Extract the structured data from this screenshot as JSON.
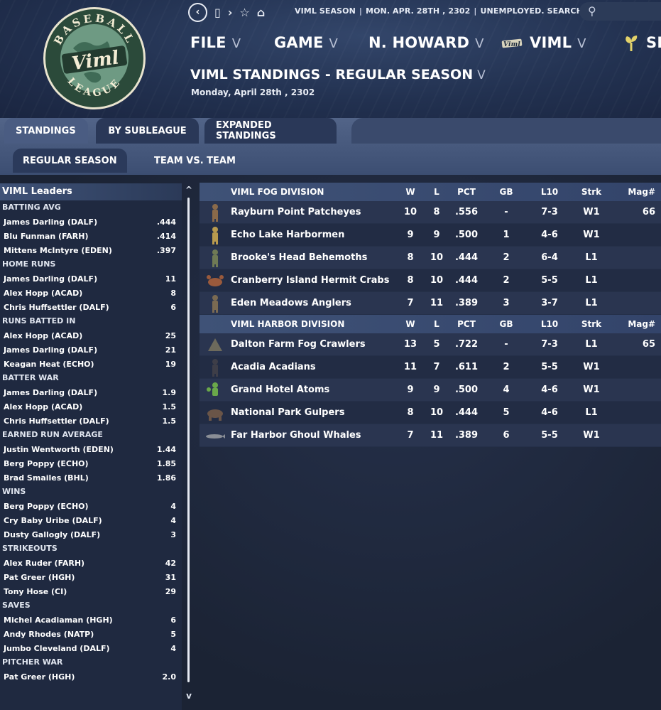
{
  "window": {
    "info": [
      "VIML SEASON",
      "MON. APR. 28TH , 2302",
      "UNEMPLOYED. SEARCH JOBS..."
    ],
    "nav_glyphs": [
      "‹",
      "▯",
      "›",
      "☆",
      "⌂"
    ]
  },
  "logo": {
    "text_top": "BASEBALL",
    "text_mid": "Viml",
    "text_bottom": "LEAGUE",
    "colors": {
      "ring": "#1d3a2a",
      "globe": "#5d8a72",
      "text": "#f3ecd4"
    }
  },
  "menu": [
    {
      "label": "FILE",
      "chev": "V"
    },
    {
      "label": "GAME",
      "chev": "V"
    },
    {
      "label": "N. HOWARD",
      "chev": "V"
    },
    {
      "label": "VIML",
      "chev": "V",
      "icon": "viml-logo-icon"
    },
    {
      "label": "SI",
      "icon": "sprout-icon"
    }
  ],
  "page": {
    "title": "VIML STANDINGS - REGULAR SEASON",
    "title_chev": "V",
    "date": "Monday, April 28th , 2302"
  },
  "tabs": [
    "STANDINGS",
    "BY SUBLEAGUE",
    "EXPANDED STANDINGS"
  ],
  "subtabs": [
    "REGULAR SEASON",
    "TEAM VS. TEAM"
  ],
  "leaders": {
    "title": "VIML Leaders",
    "categories": [
      {
        "name": "BATTING AVG",
        "rows": [
          [
            "James Darling (DALF)",
            ".444"
          ],
          [
            "Blu Funman (FARH)",
            ".414"
          ],
          [
            "Mittens McIntyre (EDEN)",
            ".397"
          ]
        ]
      },
      {
        "name": "HOME RUNS",
        "rows": [
          [
            "James Darling (DALF)",
            "11"
          ],
          [
            "Alex Hopp (ACAD)",
            "8"
          ],
          [
            "Chris Huffsettler (DALF)",
            "6"
          ]
        ]
      },
      {
        "name": "RUNS BATTED IN",
        "rows": [
          [
            "Alex Hopp (ACAD)",
            "25"
          ],
          [
            "James Darling (DALF)",
            "21"
          ],
          [
            "Keagan Heat (ECHO)",
            "19"
          ]
        ]
      },
      {
        "name": "BATTER WAR",
        "rows": [
          [
            "James Darling (DALF)",
            "1.9"
          ],
          [
            "Alex Hopp (ACAD)",
            "1.5"
          ],
          [
            "Chris Huffsettler (DALF)",
            "1.5"
          ]
        ]
      },
      {
        "name": "EARNED RUN AVERAGE",
        "rows": [
          [
            "Justin Wentworth (EDEN)",
            "1.44"
          ],
          [
            "Berg Poppy (ECHO)",
            "1.85"
          ],
          [
            "Brad Smailes (BHL)",
            "1.86"
          ]
        ]
      },
      {
        "name": "WINS",
        "rows": [
          [
            "Berg Poppy (ECHO)",
            "4"
          ],
          [
            "Cry Baby Uribe (DALF)",
            "4"
          ],
          [
            "Dusty Gallogly (DALF)",
            "3"
          ]
        ]
      },
      {
        "name": "STRIKEOUTS",
        "rows": [
          [
            "Alex Ruder (FARH)",
            "42"
          ],
          [
            "Pat Greer (HGH)",
            "31"
          ],
          [
            "Tony Hose (CI)",
            "29"
          ]
        ]
      },
      {
        "name": "SAVES",
        "rows": [
          [
            "Michel Acadiaman (HGH)",
            "6"
          ],
          [
            "Andy Rhodes (NATP)",
            "5"
          ],
          [
            "Jumbo Cleveland (DALF)",
            "4"
          ]
        ]
      },
      {
        "name": "PITCHER WAR",
        "rows": [
          [
            "Pat Greer (HGH)",
            "2.0"
          ]
        ]
      }
    ],
    "scroll_up": "^",
    "scroll_down": "v"
  },
  "columns": [
    "W",
    "L",
    "PCT",
    "GB",
    "L10",
    "Strk",
    "Mag#"
  ],
  "divisions": [
    {
      "name": "VIML FOG DIVISION",
      "teams": [
        {
          "icon": "pirate-icon",
          "color": "#8a6a4a",
          "name": "Rayburn Point Patcheyes",
          "w": "10",
          "l": "8",
          "pct": ".556",
          "gb": "-",
          "l10": "7-3",
          "strk": "W1",
          "mag": "66"
        },
        {
          "icon": "fisherman-icon",
          "color": "#b89a4e",
          "name": "Echo Lake Harbormen",
          "w": "9",
          "l": "9",
          "pct": ".500",
          "gb": "1",
          "l10": "4-6",
          "strk": "W1",
          "mag": ""
        },
        {
          "icon": "behemoth-icon",
          "color": "#6f7a55",
          "name": "Brooke's Head Behemoths",
          "w": "8",
          "l": "10",
          "pct": ".444",
          "gb": "2",
          "l10": "6-4",
          "strk": "L1",
          "mag": ""
        },
        {
          "icon": "crab-icon",
          "color": "#9a5a3c",
          "name": "Cranberry Island Hermit Crabs",
          "w": "8",
          "l": "10",
          "pct": ".444",
          "gb": "2",
          "l10": "5-5",
          "strk": "L1",
          "mag": ""
        },
        {
          "icon": "angler-icon",
          "color": "#7a6a52",
          "name": "Eden Meadows Anglers",
          "w": "7",
          "l": "11",
          "pct": ".389",
          "gb": "3",
          "l10": "3-7",
          "strk": "L1",
          "mag": ""
        }
      ]
    },
    {
      "name": "VIML HARBOR DIVISION",
      "teams": [
        {
          "icon": "crawler-icon",
          "color": "#6d6a5c",
          "name": "Dalton Farm Fog Crawlers",
          "w": "13",
          "l": "5",
          "pct": ".722",
          "gb": "-",
          "l10": "7-3",
          "strk": "L1",
          "mag": "65"
        },
        {
          "icon": "acadian-icon",
          "color": "#3e3e48",
          "name": "Acadia Acadians",
          "w": "11",
          "l": "7",
          "pct": ".611",
          "gb": "2",
          "l10": "5-5",
          "strk": "W1",
          "mag": ""
        },
        {
          "icon": "atom-icon",
          "color": "#6aa84a",
          "name": "Grand Hotel Atoms",
          "w": "9",
          "l": "9",
          "pct": ".500",
          "gb": "4",
          "l10": "4-6",
          "strk": "W1",
          "mag": ""
        },
        {
          "icon": "gulper-icon",
          "color": "#6a5548",
          "name": "National Park Gulpers",
          "w": "8",
          "l": "10",
          "pct": ".444",
          "gb": "5",
          "l10": "4-6",
          "strk": "L1",
          "mag": ""
        },
        {
          "icon": "whale-icon",
          "color": "#8a8e96",
          "name": "Far Harbor Ghoul Whales",
          "w": "7",
          "l": "11",
          "pct": ".389",
          "gb": "6",
          "l10": "5-5",
          "strk": "W1",
          "mag": ""
        }
      ]
    }
  ]
}
